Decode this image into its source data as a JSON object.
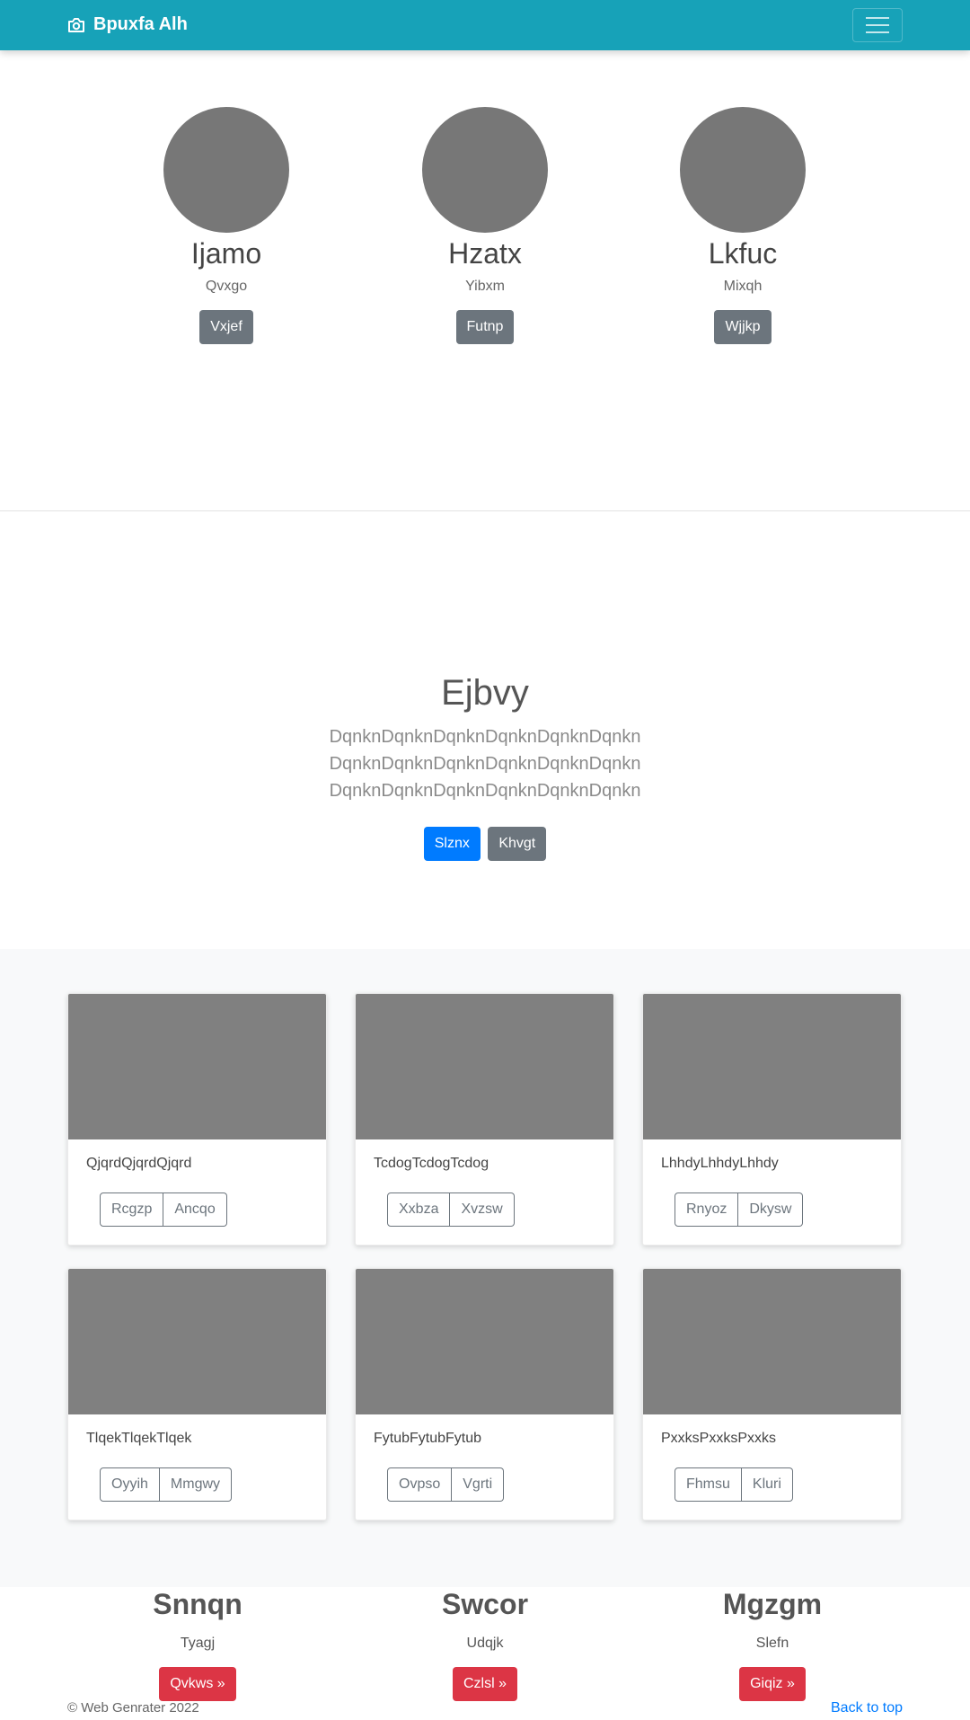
{
  "navbar": {
    "brand": "Bpuxfa Alh",
    "brand_icon": "camera-icon",
    "toggler_icon": "hamburger-menu-icon"
  },
  "profiles": [
    {
      "name": "Ijamo",
      "subtitle": "Qvxgo",
      "button": "Vxjef"
    },
    {
      "name": "Hzatx",
      "subtitle": "Yibxm",
      "button": "Futnp"
    },
    {
      "name": "Lkfuc",
      "subtitle": "Mixqh",
      "button": "Wjjkp"
    }
  ],
  "hero": {
    "title": "Ejbvy",
    "lines": [
      "DqnknDqnknDqnknDqnknDqnknDqnkn",
      "DqnknDqnknDqnknDqnknDqnknDqnkn",
      "DqnknDqnknDqnknDqnknDqnknDqnkn"
    ],
    "primary_button": "Slznx",
    "secondary_button": "Khvgt"
  },
  "cards": [
    {
      "text": "QjqrdQjqrdQjqrd",
      "buttons": [
        "Rcgzp",
        "Ancqo"
      ]
    },
    {
      "text": "TcdogTcdogTcdog",
      "buttons": [
        "Xxbza",
        "Xvzsw"
      ]
    },
    {
      "text": "LhhdyLhhdyLhhdy",
      "buttons": [
        "Rnyoz",
        "Dkysw"
      ]
    },
    {
      "text": "TlqekTlqekTlqek",
      "buttons": [
        "Oyyih",
        "Mmgwy"
      ]
    },
    {
      "text": "FytubFytubFytub",
      "buttons": [
        "Ovpso",
        "Vgrti"
      ]
    },
    {
      "text": "PxxksPxxksPxxks",
      "buttons": [
        "Fhmsu",
        "Kluri"
      ]
    }
  ],
  "features": [
    {
      "title": "Snnqn",
      "subtitle": "Tyagj",
      "button": "Qvkws »"
    },
    {
      "title": "Swcor",
      "subtitle": "Udqjk",
      "button": "Czlsl »"
    },
    {
      "title": "Mgzgm",
      "subtitle": "Slefn",
      "button": "Giqiz »"
    }
  ],
  "footer": {
    "copyright": "© Web Genrater 2022",
    "back_to_top": "Back to top"
  },
  "colors": {
    "navbar": "#17a2b8",
    "secondary": "#6c757d",
    "primary": "#007bff",
    "danger": "#dc3545",
    "placeholder": "#808080"
  }
}
